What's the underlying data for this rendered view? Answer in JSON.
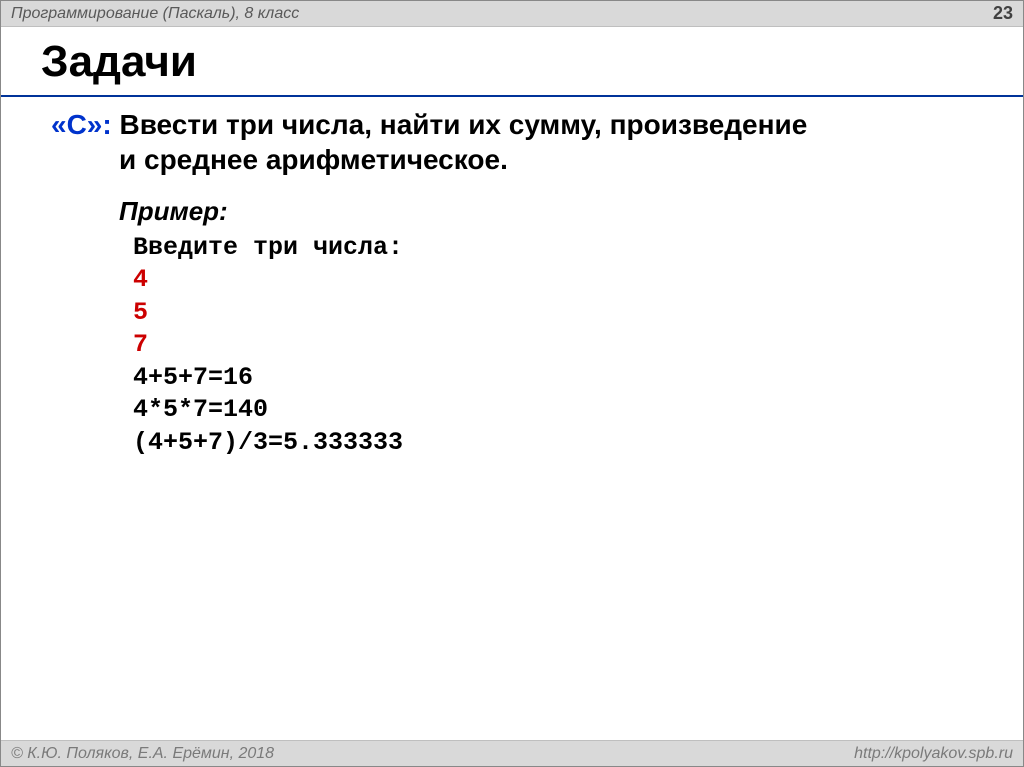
{
  "header": {
    "course": "Программирование (Паскаль), 8 класс",
    "page": "23"
  },
  "title": "Задачи",
  "task": {
    "label": "«С»:",
    "line1_rest": " Ввести три числа, найти их сумму, произведение",
    "line2": "и среднее арифметическое."
  },
  "example": {
    "label": "Пример:",
    "prompt": "Введите три числа:",
    "inputs": [
      "4",
      "5",
      "7"
    ],
    "outputs": [
      "4+5+7=16",
      "4*5*7=140",
      "(4+5+7)/3=5.333333"
    ]
  },
  "footer": {
    "copyright": "© К.Ю. Поляков, Е.А. Ерёмин, 2018",
    "url": "http://kpolyakov.spb.ru"
  }
}
